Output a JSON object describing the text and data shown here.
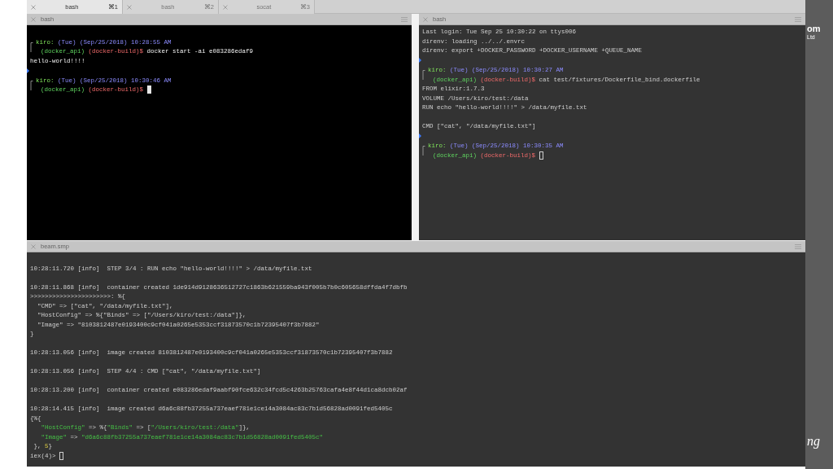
{
  "tabs": [
    {
      "title": "bash",
      "shortcut": "⌘1",
      "selected": true
    },
    {
      "title": "bash",
      "shortcut": "⌘2",
      "selected": false
    },
    {
      "title": "socat",
      "shortcut": "⌘3",
      "selected": false
    }
  ],
  "panes": [
    {
      "title": "bash",
      "kind": "black",
      "lines": [
        {
          "kind": "blank"
        },
        {
          "kind": "prompt",
          "lines": [
            [
              {
                "text": "kiro: ",
                "kind": "user"
              },
              {
                "text": "(Tue) (Sep/25/2018) 10:28:55 AM",
                "kind": "date"
              }
            ],
            [
              {
                "text": "(docker_api) ",
                "kind": "env"
              },
              {
                "text": "(docker-build)$",
                "kind": "branch"
              },
              {
                "text": " docker start -ai e083286edaf9",
                "kind": "cmd"
              }
            ]
          ]
        },
        {
          "kind": "text",
          "segments": [
            {
              "text": "hello-world!!!!",
              "kind": "cmd"
            }
          ]
        },
        {
          "kind": "marker"
        },
        {
          "kind": "prompt",
          "cursor": true,
          "filled": true,
          "lines": [
            [
              {
                "text": "kiro: ",
                "kind": "user"
              },
              {
                "text": "(Tue) (Sep/25/2018) 10:30:46 AM",
                "kind": "date"
              }
            ],
            [
              {
                "text": "(docker_api) ",
                "kind": "env"
              },
              {
                "text": "(docker-build)$",
                "kind": "branch"
              }
            ]
          ]
        }
      ]
    },
    {
      "title": "bash",
      "kind": "dark",
      "lines": [
        {
          "kind": "text",
          "segments": [
            {
              "text": "Last login: Tue Sep 25 10:30:22 on ttys006",
              "kind": "plain"
            }
          ]
        },
        {
          "kind": "text",
          "segments": [
            {
              "text": "direnv: loading ../../.envrc",
              "kind": "plain"
            }
          ]
        },
        {
          "kind": "text",
          "segments": [
            {
              "text": "direnv: export +DOCKER_PASSWORD +DOCKER_USERNAME +QUEUE_NAME",
              "kind": "plain"
            }
          ]
        },
        {
          "kind": "marker"
        },
        {
          "kind": "prompt",
          "lines": [
            [
              {
                "text": "kiro: ",
                "kind": "user"
              },
              {
                "text": "(Tue) (Sep/25/2018) 10:30:27 AM",
                "kind": "date"
              }
            ],
            [
              {
                "text": "(docker_api) ",
                "kind": "env"
              },
              {
                "text": "(docker-build)$",
                "kind": "branch"
              },
              {
                "text": " cat test/fixtures/Dockerfile_bind.dockerfile",
                "kind": "plain"
              }
            ]
          ]
        },
        {
          "kind": "text",
          "segments": [
            {
              "text": "FROM elixir:1.7.3",
              "kind": "plain"
            }
          ]
        },
        {
          "kind": "text",
          "segments": [
            {
              "text": "VOLUME /Users/kiro/test:/data",
              "kind": "plain"
            }
          ]
        },
        {
          "kind": "text",
          "segments": [
            {
              "text": "RUN echo \"hello-world!!!!\" > /data/myfile.txt",
              "kind": "plain"
            }
          ]
        },
        {
          "kind": "blank"
        },
        {
          "kind": "text",
          "segments": [
            {
              "text": "CMD [\"cat\", \"/data/myfile.txt\"]",
              "kind": "plain"
            }
          ]
        },
        {
          "kind": "marker"
        },
        {
          "kind": "prompt",
          "cursor": true,
          "filled": false,
          "lines": [
            [
              {
                "text": "kiro: ",
                "kind": "user"
              },
              {
                "text": "(Tue) (Sep/25/2018) 10:30:35 AM",
                "kind": "date"
              }
            ],
            [
              {
                "text": "(docker_api) ",
                "kind": "env"
              },
              {
                "text": "(docker-build)$",
                "kind": "branch"
              }
            ]
          ]
        }
      ]
    },
    {
      "title": "beam.smp",
      "kind": "dark",
      "lines": [
        {
          "kind": "blank"
        },
        {
          "kind": "text",
          "segments": [
            {
              "text": "10:28:11.720 [info]  STEP 3/4 : RUN echo \"hello-world!!!!\" > /data/myfile.txt",
              "kind": "plain"
            }
          ]
        },
        {
          "kind": "blank"
        },
        {
          "kind": "text",
          "segments": [
            {
              "text": "10:28:11.868 [info]  container created 1de914d9128636512727c1863b621559ba943f005b7b0c605658dffda4f7dbfb",
              "kind": "plain"
            }
          ]
        },
        {
          "kind": "text",
          "segments": [
            {
              "text": ">>>>>>>>>>>>>>>>>>>>>>: %{",
              "kind": "plain"
            }
          ]
        },
        {
          "kind": "text",
          "segments": [
            {
              "text": "  \"CMD\" => [\"cat\", \"/data/myfile.txt\"],",
              "kind": "plain"
            }
          ]
        },
        {
          "kind": "text",
          "segments": [
            {
              "text": "  \"HostConfig\" => %{\"Binds\" => [\"/Users/kiro/test:/data\"]},",
              "kind": "plain"
            }
          ]
        },
        {
          "kind": "text",
          "segments": [
            {
              "text": "  \"Image\" => \"8103812487e0193400c9cf041a0265e5353ccf31873570c1b72395407f3b7882\"",
              "kind": "plain"
            }
          ]
        },
        {
          "kind": "text",
          "segments": [
            {
              "text": "}",
              "kind": "plain"
            }
          ]
        },
        {
          "kind": "blank"
        },
        {
          "kind": "text",
          "segments": [
            {
              "text": "10:28:13.056 [info]  image created 8103812487e0193400c9cf041a0265e5353ccf31873570c1b72395407f3b7882",
              "kind": "plain"
            }
          ]
        },
        {
          "kind": "blank"
        },
        {
          "kind": "text",
          "segments": [
            {
              "text": "10:28:13.056 [info]  STEP 4/4 : CMD [\"cat\", \"/data/myfile.txt\"]",
              "kind": "plain"
            }
          ]
        },
        {
          "kind": "blank"
        },
        {
          "kind": "text",
          "segments": [
            {
              "text": "10:28:13.200 [info]  container created e083286edaf9aabf90fce632c34fcd5c4263b25763cafa4e8f44d1ca8dcb02af",
              "kind": "plain"
            }
          ]
        },
        {
          "kind": "blank"
        },
        {
          "kind": "text",
          "segments": [
            {
              "text": "10:28:14.415 [info]  image created d6a6c88fb37255a737eaef781e1ce14a3084ac83c7b1d56828ad0091fed5405c",
              "kind": "plain"
            }
          ]
        },
        {
          "kind": "text",
          "segments": [
            {
              "text": "{%{",
              "kind": "plain"
            }
          ]
        },
        {
          "kind": "text",
          "segments": [
            {
              "text": "   \"HostConfig\"",
              "kind": "str"
            },
            {
              "text": " => %{",
              "kind": "plain"
            },
            {
              "text": "\"Binds\"",
              "kind": "str"
            },
            {
              "text": " => [",
              "kind": "plain"
            },
            {
              "text": "\"/Users/kiro/test:/data\"",
              "kind": "str"
            },
            {
              "text": "]},",
              "kind": "plain"
            }
          ]
        },
        {
          "kind": "text",
          "segments": [
            {
              "text": "   \"Image\"",
              "kind": "str"
            },
            {
              "text": " => ",
              "kind": "plain"
            },
            {
              "text": "\"d6a6c88fb37255a737eaef781e1ce14a3084ac83c7b1d56828ad0091fed5405c\"",
              "kind": "str"
            }
          ]
        },
        {
          "kind": "text",
          "segments": [
            {
              "text": " }, ",
              "kind": "plain"
            },
            {
              "text": "5",
              "kind": "num"
            },
            {
              "text": "}",
              "kind": "plain"
            }
          ]
        },
        {
          "kind": "prompt_line",
          "cursor": true,
          "filled": false,
          "segments": [
            {
              "text": "iex(4)> ",
              "kind": "plain"
            }
          ]
        }
      ]
    }
  ],
  "edge_texts": [
    "om",
    "Ltd",
    "ng"
  ]
}
